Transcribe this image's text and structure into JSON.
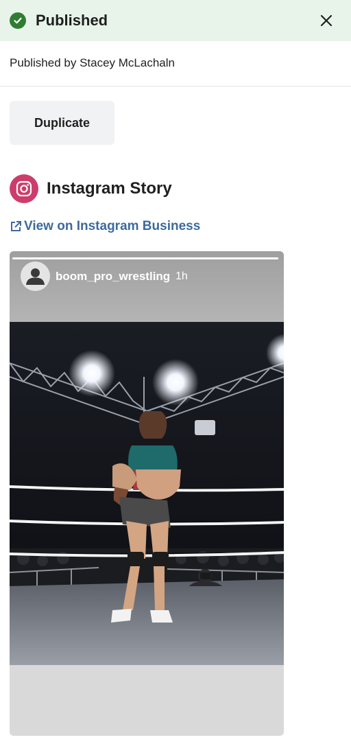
{
  "status": {
    "title": "Published",
    "icon": "check-circle-icon",
    "color": "#2e7d32",
    "background": "#e8f4ea"
  },
  "published_by": "Published by Stacey McLachaln",
  "actions": {
    "duplicate_label": "Duplicate"
  },
  "channel": {
    "title": "Instagram Story",
    "icon": "instagram-icon",
    "brand_color": "#cc3d6c",
    "link_label": "View on Instagram Business",
    "link_color": "#3d6a9c"
  },
  "story": {
    "username": "boom_pro_wrestling",
    "time": "1h",
    "progress": 1.0,
    "media": "wrestling-ring-photo"
  }
}
